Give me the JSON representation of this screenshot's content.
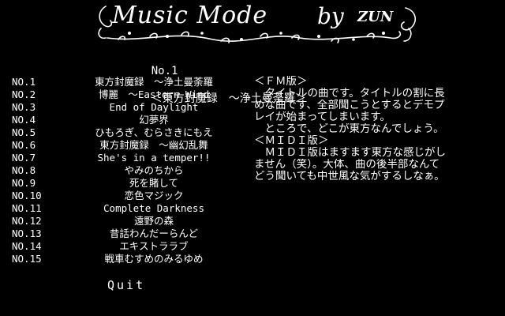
{
  "header": {
    "title": "Music Mode",
    "by": "by",
    "author": "ZUN"
  },
  "now_playing": {
    "number": "No.1",
    "title": "＜東方封魔録　～浄土曼荼羅＞"
  },
  "tracks": [
    {
      "number": "NO.1",
      "title": "東方封魔録　～浄土曼荼羅"
    },
    {
      "number": "NO.2",
      "title": "博麗　～Eastern Wind"
    },
    {
      "number": "NO.3",
      "title": "End of Daylight"
    },
    {
      "number": "NO.4",
      "title": "幻夢界"
    },
    {
      "number": "NO.5",
      "title": "ひもろぎ、むらさきにもえ"
    },
    {
      "number": "NO.6",
      "title": "東方封魔録　～幽幻乱舞"
    },
    {
      "number": "NO.7",
      "title": "She's in a temper!!"
    },
    {
      "number": "NO.8",
      "title": "やみのちから"
    },
    {
      "number": "NO.9",
      "title": "死を賭して"
    },
    {
      "number": "NO.10",
      "title": "恋色マジック"
    },
    {
      "number": "NO.11",
      "title": "Complete Darkness"
    },
    {
      "number": "NO.12",
      "title": "遠野の森"
    },
    {
      "number": "NO.13",
      "title": "昔話わんだーらんど"
    },
    {
      "number": "NO.14",
      "title": "エキストララブ"
    },
    {
      "number": "NO.15",
      "title": "戦車むすめのみるゆめ"
    }
  ],
  "description": [
    "＜ＦＭ版＞",
    "　タイトルの曲です。タイトルの割に長",
    "めな曲です、全部聞こうとするとデモプ",
    "レイが始まってしまいます。",
    "　ところで、どこが東方なんでしょう。",
    "＜ＭＩＤＩ版＞",
    "　ＭＩＤＩ版はますます東方な感じがし",
    "ません（笑）。大体、曲の後半部なんて",
    "どう聞いても中世風な気がするしなぁ。"
  ],
  "quit_label": "Quit",
  "colors": {
    "background": "#000000",
    "text": "#ffffff"
  }
}
